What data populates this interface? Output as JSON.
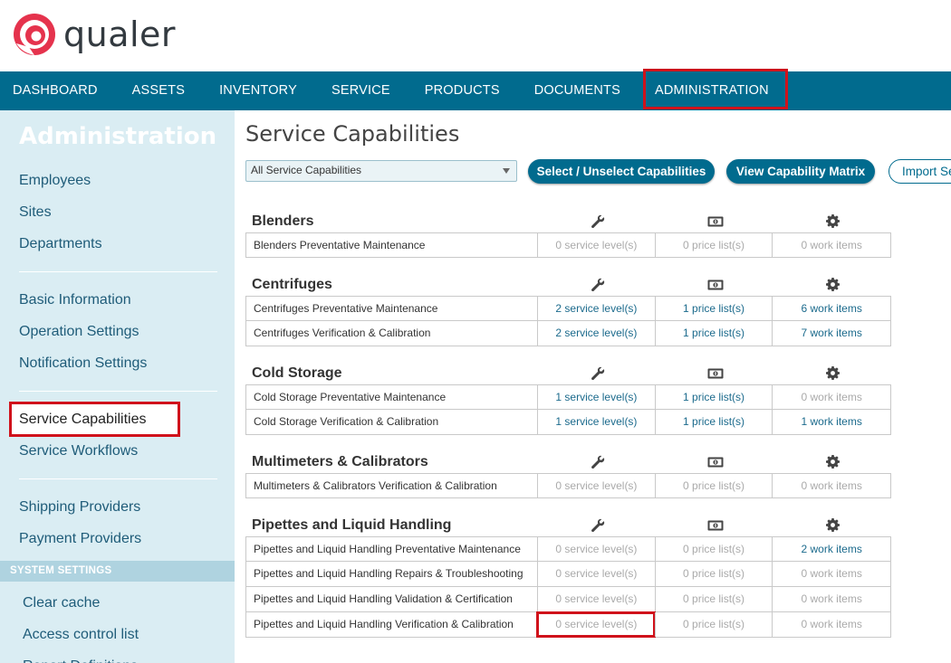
{
  "brand": {
    "name": "qualer",
    "accent": "#e5334d",
    "nav_bg": "#016b8e",
    "sidebar_bg": "#daedf3",
    "highlight": "#d0121b"
  },
  "nav": [
    "DASHBOARD",
    "ASSETS",
    "INVENTORY",
    "SERVICE",
    "PRODUCTS",
    "DOCUMENTS",
    "ADMINISTRATION"
  ],
  "sidebar": {
    "title": "Administration",
    "group1": [
      "Employees",
      "Sites",
      "Departments"
    ],
    "group2": [
      "Basic Information",
      "Operation Settings",
      "Notification Settings"
    ],
    "group3": [
      "Service Capabilities",
      "Service Workflows"
    ],
    "group4": [
      "Shipping Providers",
      "Payment Providers"
    ],
    "section": "SYSTEM SETTINGS",
    "system": [
      "Clear cache",
      "Access control list",
      "Report Definitions"
    ]
  },
  "main": {
    "title": "Service Capabilities",
    "filter": "All Service Capabilities",
    "buttons": {
      "select": "Select / Unselect Capabilities",
      "matrix": "View Capability Matrix",
      "import": "Import Se"
    },
    "column_icons": [
      "wrench-icon",
      "price-list-icon",
      "gear-icon"
    ]
  },
  "categories": [
    {
      "name": "Blenders",
      "rows": [
        [
          "Blenders Preventative Maintenance",
          "0 service level(s)",
          "0 price list(s)",
          "0 work items"
        ]
      ]
    },
    {
      "name": "Centrifuges",
      "rows": [
        [
          "Centrifuges Preventative Maintenance",
          "2 service level(s)",
          "1 price list(s)",
          "6 work items"
        ],
        [
          "Centrifuges Verification & Calibration",
          "2 service level(s)",
          "1 price list(s)",
          "7 work items"
        ]
      ]
    },
    {
      "name": "Cold Storage",
      "rows": [
        [
          "Cold Storage Preventative Maintenance",
          "1 service level(s)",
          "1 price list(s)",
          "0 work items"
        ],
        [
          "Cold Storage Verification & Calibration",
          "1 service level(s)",
          "1 price list(s)",
          "1 work items"
        ]
      ]
    },
    {
      "name": "Multimeters & Calibrators",
      "rows": [
        [
          "Multimeters & Calibrators Verification & Calibration",
          "0 service level(s)",
          "0 price list(s)",
          "0 work items"
        ]
      ]
    },
    {
      "name": "Pipettes and Liquid Handling",
      "rows": [
        [
          "Pipettes and Liquid Handling Preventative Maintenance",
          "0 service level(s)",
          "0 price list(s)",
          "2 work items"
        ],
        [
          "Pipettes and Liquid Handling Repairs & Troubleshooting",
          "0 service level(s)",
          "0 price list(s)",
          "0 work items"
        ],
        [
          "Pipettes and Liquid Handling Validation & Certification",
          "0 service level(s)",
          "0 price list(s)",
          "0 work items"
        ],
        [
          "Pipettes and Liquid Handling Verification & Calibration",
          "0 service level(s)",
          "0 price list(s)",
          "0 work items"
        ]
      ]
    }
  ]
}
